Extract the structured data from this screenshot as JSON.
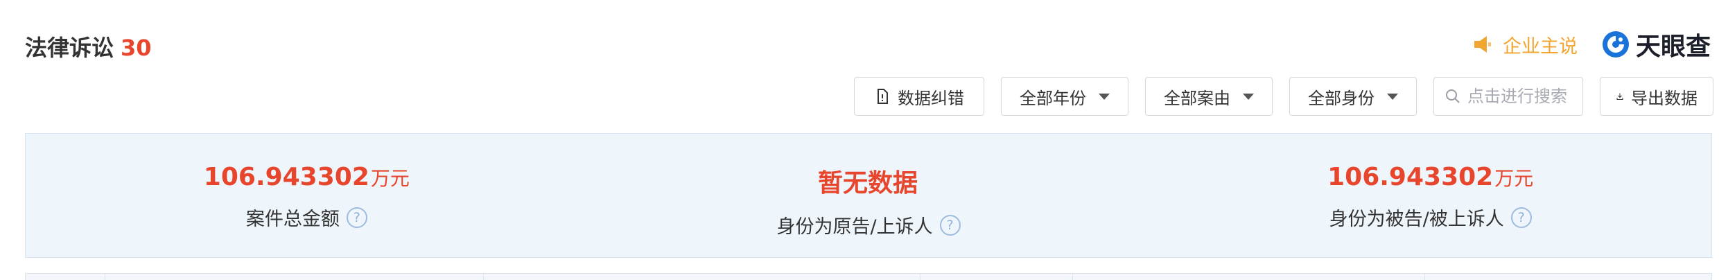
{
  "header": {
    "title": "法律诉讼",
    "count": "30",
    "speaker_label": "企业主说",
    "brand_name": "天眼查"
  },
  "toolbar": {
    "correct_label": "数据纠错",
    "year_filter": "全部年份",
    "cause_filter": "全部案由",
    "role_filter": "全部身份",
    "search_placeholder": "点击进行搜索",
    "export_label": "导出数据"
  },
  "summary": {
    "total": {
      "value": "106.943302",
      "unit": "万元",
      "label": "案件总金额"
    },
    "plaintiff": {
      "value": "暂无数据",
      "unit": "",
      "label": "身份为原告/上诉人"
    },
    "defendant": {
      "value": "106.943302",
      "unit": "万元",
      "label": "身份为被告/被上诉人"
    },
    "help_glyph": "?"
  },
  "colors": {
    "accent_red": "#e8452d",
    "brand_blue": "#1a73d9",
    "speaker_orange": "#f2a531",
    "panel_bg": "#eef5fb"
  },
  "icons": [
    "speaker-icon",
    "tianyancha-logo-icon",
    "document-icon",
    "caret-down-icon",
    "search-icon",
    "download-icon",
    "help-icon"
  ]
}
